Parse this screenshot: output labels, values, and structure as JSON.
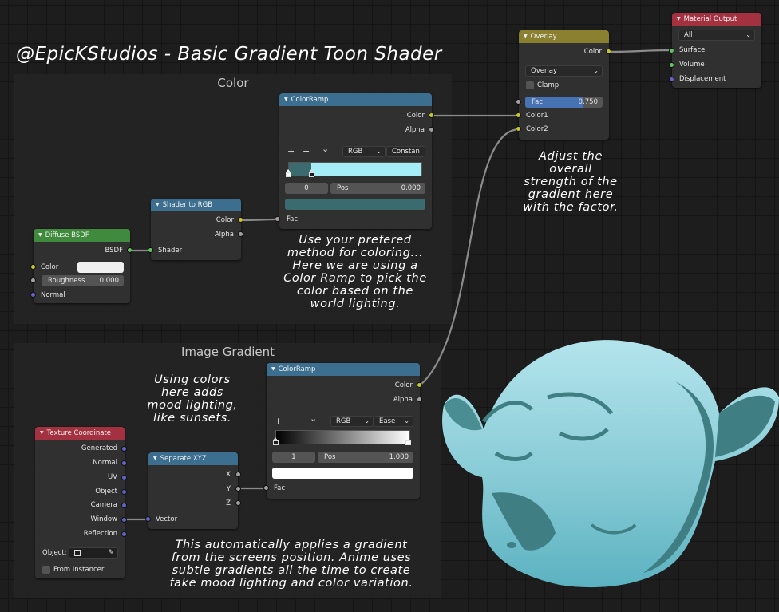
{
  "title": "@EpicKStudios - Basic Gradient Toon Shader",
  "frames": {
    "color": "Color",
    "image_gradient": "Image Gradient"
  },
  "notes": {
    "coloring": "Use your prefered\nmethod for coloring...\nHere we are using a\nColor Ramp to pick the\ncolor based on the\nworld lighting.",
    "overlay": "Adjust the\noverall\nstrength of the\ngradient here\nwith the factor.",
    "mood": "Using colors\nhere adds\nmood lighting,\nlike sunsets.",
    "gradient": "This automatically applies a gradient\nfrom the screens position. Anime uses\nsubtle gradients all the time to create\nfake mood lighting and color variation."
  },
  "colors": {
    "color_ramp_dark": "#3b6b6f",
    "color_ramp_light": "#a5eef8",
    "ramp_output": "#3a6b6f",
    "monkey_top": "#a8dde6",
    "monkey_dark": "#3f7f84"
  },
  "nodes": {
    "diffuse": {
      "title": "Diffuse BSDF",
      "out": "BSDF",
      "color": "Color",
      "roughness_label": "Roughness",
      "roughness": "0.000",
      "normal": "Normal"
    },
    "shader_to_rgb": {
      "title": "Shader to RGB",
      "color": "Color",
      "alpha": "Alpha",
      "shader": "Shader"
    },
    "ramp1": {
      "title": "ColorRamp",
      "color": "Color",
      "alpha": "Alpha",
      "mode": "RGB",
      "interp": "Constan",
      "index": "0",
      "pos_label": "Pos",
      "pos": "0.000",
      "fac": "Fac"
    },
    "overlay": {
      "title": "Overlay",
      "color": "Color",
      "blend": "Overlay",
      "clamp": "Clamp",
      "fac_label": "Fac",
      "fac": "0.750",
      "color1": "Color1",
      "color2": "Color2"
    },
    "material_output": {
      "title": "Material Output",
      "target": "All",
      "surface": "Surface",
      "volume": "Volume",
      "displacement": "Displacement"
    },
    "ramp2": {
      "title": "ColorRamp",
      "color": "Color",
      "alpha": "Alpha",
      "mode": "RGB",
      "interp": "Ease",
      "index": "1",
      "pos_label": "Pos",
      "pos": "1.000",
      "fac": "Fac"
    },
    "texcoord": {
      "title": "Texture Coordinate",
      "outputs": [
        "Generated",
        "Normal",
        "UV",
        "Object",
        "Camera",
        "Window",
        "Reflection"
      ],
      "object_label": "Object:",
      "from_instancer": "From Instancer"
    },
    "separate": {
      "title": "Separate XYZ",
      "x": "X",
      "y": "Y",
      "z": "Z",
      "vector": "Vector"
    }
  },
  "controls": {
    "add": "+",
    "remove": "−",
    "menu": "⌄",
    "collapse": "▼"
  }
}
